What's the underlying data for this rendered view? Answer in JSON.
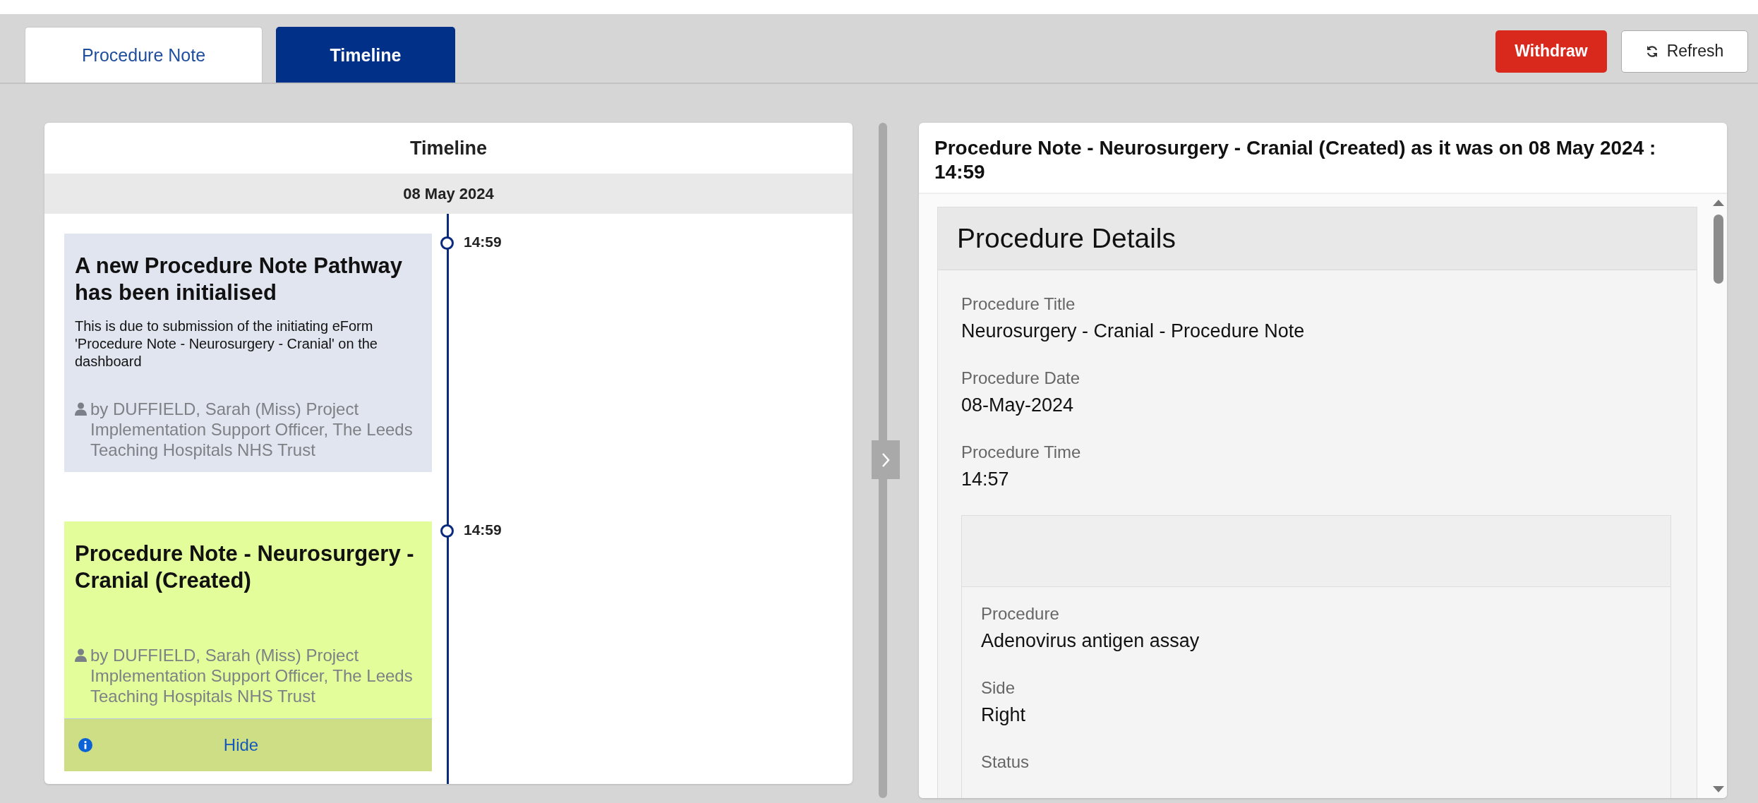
{
  "tabs": [
    {
      "label": "Procedure Note",
      "selected": false
    },
    {
      "label": "Timeline",
      "selected": true
    }
  ],
  "actions": [
    {
      "kind": "danger",
      "label": "Withdraw"
    },
    {
      "kind": "refresh",
      "label": "Refresh"
    }
  ],
  "timeline": {
    "title": "Timeline",
    "date": "08 May 2024",
    "events": [
      {
        "time": "14:59",
        "title": "A new Procedure Note Pathway has been initialised",
        "description": "This is due to submission of the initiating eForm 'Procedure Note - Neurosurgery - Cranial' on the dashboard",
        "author": "by DUFFIELD, Sarah (Miss) Project Implementation Support Officer, The Leeds Teaching Hospitals NHS Trust",
        "color": "#e1e5ef"
      },
      {
        "time": "14:59",
        "title": "Procedure Note - Neurosurgery - Cranial (Created)",
        "author": "by DUFFIELD, Sarah (Miss) Project Implementation Support Officer, The Leeds Teaching Hospitals NHS Trust",
        "color": "#e4fd9b",
        "toggle": "Hide"
      }
    ]
  },
  "detail": {
    "heading": "Procedure Note - Neurosurgery - Cranial (Created) as it was on 08 May 2024 : 14:59",
    "section": {
      "title": "Procedure Details",
      "fields": [
        {
          "label": "Procedure Title",
          "value": "Neurosurgery - Cranial - Procedure Note"
        },
        {
          "label": "Procedure Date",
          "value": "08-May-2024"
        },
        {
          "label": "Procedure Time",
          "value": "14:57"
        }
      ],
      "subsection": {
        "fields": [
          {
            "label": "Procedure",
            "value": "Adenovirus antigen assay"
          },
          {
            "label": "Side",
            "value": "Right"
          },
          {
            "label": "Status"
          }
        ]
      }
    }
  }
}
